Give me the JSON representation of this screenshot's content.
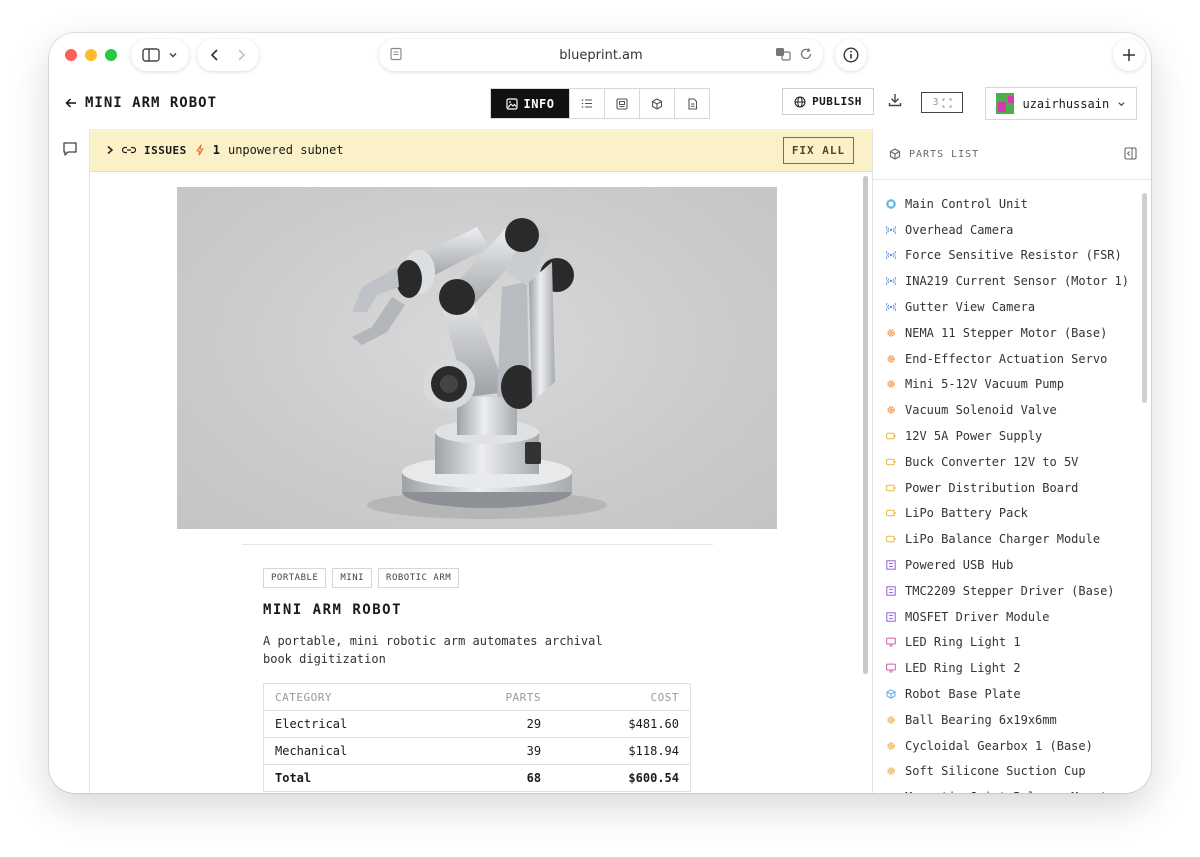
{
  "browser": {
    "url": "blueprint.am"
  },
  "header": {
    "title": "MINI ARM ROBOT",
    "active_tab": "INFO",
    "publish_label": "PUBLISH",
    "counter": "3",
    "username": "uzairhussain"
  },
  "issues": {
    "label": "ISSUES",
    "count": "1",
    "message": "unpowered subnet",
    "fix_label": "FIX ALL"
  },
  "project": {
    "tags": [
      "PORTABLE",
      "MINI",
      "ROBOTIC ARM"
    ],
    "title": "MINI ARM ROBOT",
    "description": "A portable, mini robotic arm automates archival book digitization",
    "table": {
      "headers": [
        "CATEGORY",
        "PARTS",
        "COST"
      ],
      "rows": [
        [
          "Electrical",
          "29",
          "$481.60"
        ],
        [
          "Mechanical",
          "39",
          "$118.94"
        ],
        [
          "Total",
          "68",
          "$600.54"
        ]
      ]
    }
  },
  "parts_list": {
    "title": "PARTS LIST",
    "items": [
      {
        "name": "Main Control Unit",
        "icon": "chip-icon",
        "color": "#3aa7d9"
      },
      {
        "name": "Overhead Camera",
        "icon": "signal-icon",
        "color": "#5b8fe0"
      },
      {
        "name": "Force Sensitive Resistor (FSR)",
        "icon": "signal-icon",
        "color": "#5b8fe0"
      },
      {
        "name": "INA219 Current Sensor (Motor 1)",
        "icon": "signal-icon",
        "color": "#5b8fe0"
      },
      {
        "name": "Gutter View Camera",
        "icon": "signal-icon",
        "color": "#5b8fe0"
      },
      {
        "name": "NEMA 11 Stepper Motor (Base)",
        "icon": "gear-icon",
        "color": "#ef8a3a"
      },
      {
        "name": "End-Effector Actuation Servo",
        "icon": "gear-icon",
        "color": "#ef8a3a"
      },
      {
        "name": "Mini 5-12V Vacuum Pump",
        "icon": "gear-icon",
        "color": "#ef8a3a"
      },
      {
        "name": "Vacuum Solenoid Valve",
        "icon": "gear-icon",
        "color": "#ef8a3a"
      },
      {
        "name": "12V 5A Power Supply",
        "icon": "battery-icon",
        "color": "#e8b93a"
      },
      {
        "name": "Buck Converter 12V to 5V",
        "icon": "battery-icon",
        "color": "#e8b93a"
      },
      {
        "name": "Power Distribution Board",
        "icon": "battery-icon",
        "color": "#e8b93a"
      },
      {
        "name": "LiPo Battery Pack",
        "icon": "battery-icon",
        "color": "#e8b93a"
      },
      {
        "name": "LiPo Balance Charger Module",
        "icon": "battery-icon",
        "color": "#e8b93a"
      },
      {
        "name": "Powered USB Hub",
        "icon": "board-icon",
        "color": "#9a6fd8"
      },
      {
        "name": "TMC2209 Stepper Driver (Base)",
        "icon": "board-icon",
        "color": "#9a6fd8"
      },
      {
        "name": "MOSFET Driver Module",
        "icon": "board-icon",
        "color": "#9a6fd8"
      },
      {
        "name": "LED Ring Light 1",
        "icon": "monitor-icon",
        "color": "#d65aa8"
      },
      {
        "name": "LED Ring Light 2",
        "icon": "monitor-icon",
        "color": "#d65aa8"
      },
      {
        "name": "Robot Base Plate",
        "icon": "cube-icon",
        "color": "#5aaee0"
      },
      {
        "name": "Ball Bearing 6x19x6mm",
        "icon": "gear-icon",
        "color": "#e8a93a"
      },
      {
        "name": "Cycloidal Gearbox 1 (Base)",
        "icon": "gear-icon",
        "color": "#e8a93a"
      },
      {
        "name": "Soft Silicone Suction Cup",
        "icon": "gear-icon",
        "color": "#e8a93a"
      },
      {
        "name": "Magnetic Joint Balance Mount",
        "icon": "gear-icon",
        "color": "#e8a93a"
      }
    ]
  }
}
